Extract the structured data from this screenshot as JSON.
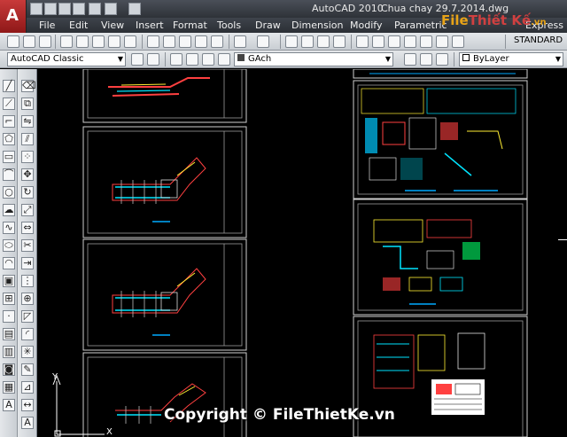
{
  "title_bar": {
    "app_title": "AutoCAD 2010",
    "file_name": "Chua chay 29.7.2014.dwg"
  },
  "app_button": {
    "label": "A"
  },
  "menu": {
    "items": [
      "File",
      "Edit",
      "View",
      "Insert",
      "Format",
      "Tools",
      "Draw",
      "Dimension",
      "Modify",
      "Parametric",
      "Express"
    ]
  },
  "watermark": {
    "logo_part1": "File",
    "logo_part2": "Thiết Kế",
    "logo_part3": ".vn",
    "copyright": "Copyright © FileThietKe.vn"
  },
  "toolbar_standard": {
    "text_style_value": "STANDARD"
  },
  "toolbar_layers": {
    "workspace_value": "AutoCAD Classic",
    "layer_value": "GAch",
    "color_value": "ByLayer"
  },
  "ucs": {
    "x_label": "X",
    "y_label": "Y"
  },
  "colors": {
    "background": "#000000",
    "toolbar": "#d6dadf",
    "titlebar": "#3a3e45",
    "app_button": "#b02424",
    "accent_cyan": "#00e5ff",
    "accent_red": "#ff3030",
    "accent_yellow": "#ffee33"
  }
}
